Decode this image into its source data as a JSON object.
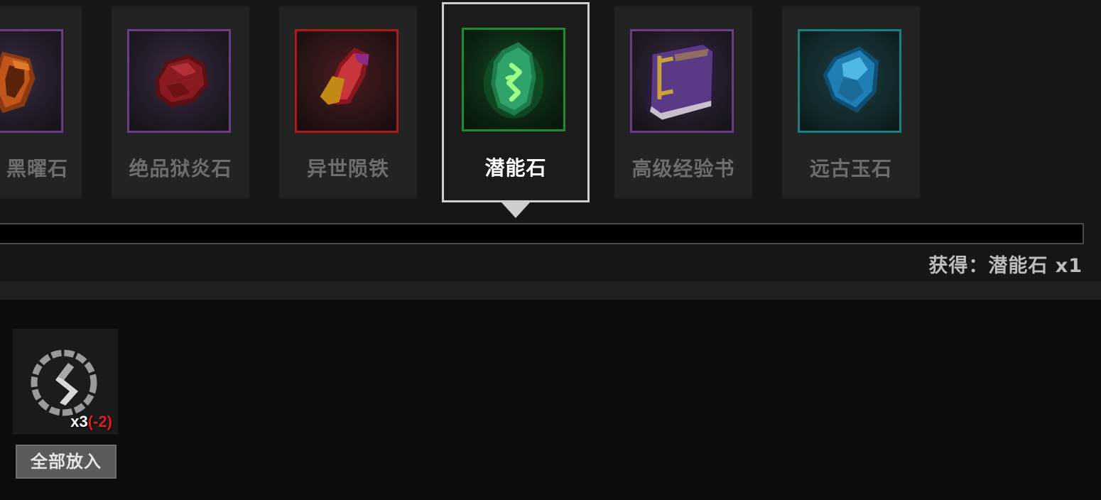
{
  "items": [
    {
      "name": "黑曜石",
      "icon": "obsidian-icon",
      "selected": false
    },
    {
      "name": "绝品狱炎石",
      "icon": "hellfire-stone-icon",
      "selected": false
    },
    {
      "name": "异世陨铁",
      "icon": "meteorite-iron-icon",
      "selected": false
    },
    {
      "name": "潜能石",
      "icon": "potential-stone-icon",
      "selected": true
    },
    {
      "name": "高级经验书",
      "icon": "exp-book-icon",
      "selected": false
    },
    {
      "name": "远古玉石",
      "icon": "ancient-jade-icon",
      "selected": false
    }
  ],
  "progress": {
    "fraction": 0.0
  },
  "obtain": {
    "text": "获得：潜能石 x1"
  },
  "material": {
    "icon": "rune-ring-icon",
    "count": "x3",
    "delta": "(-2)"
  },
  "actions": {
    "put_all_label": "全部放入"
  },
  "colors": {
    "selected_border": "#cfcfcf",
    "purple_frame": "#6b3d86",
    "red_frame": "#a81c1c",
    "green_frame": "#1f8a2f",
    "teal_frame": "#1b7f80",
    "delta_red": "#e01c1c"
  }
}
